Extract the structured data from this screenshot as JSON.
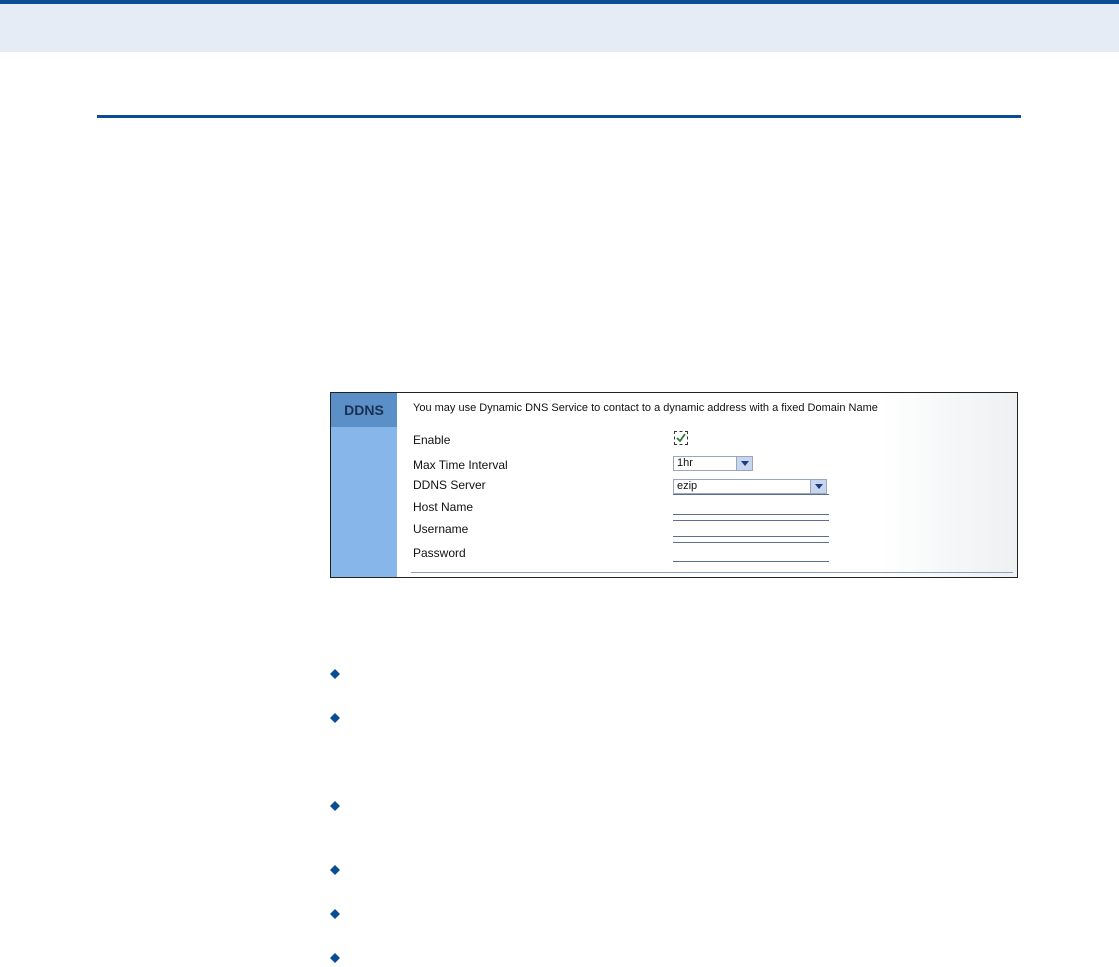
{
  "ddns_panel": {
    "tab_label": "DDNS",
    "intro": "You may use Dynamic DNS Service to contact to a dynamic address with a fixed Domain Name",
    "enable_label": "Enable",
    "max_time_interval_label": "Max Time Interval",
    "max_time_interval_value": "1hr",
    "ddns_server_label": "DDNS Server",
    "ddns_server_value": "ezip",
    "host_name_label": "Host Name",
    "host_name_value": "",
    "username_label": "Username",
    "username_value": "",
    "password_label": "Password",
    "password_value": "",
    "enable_checked": true
  },
  "bullet_icon": "diamond-bullet-icon",
  "colors": {
    "accent": "#0a4d94",
    "panel_side": "#87b6ea",
    "panel_tab": "#5a8fc8",
    "header_band": "#e6ecf5"
  }
}
